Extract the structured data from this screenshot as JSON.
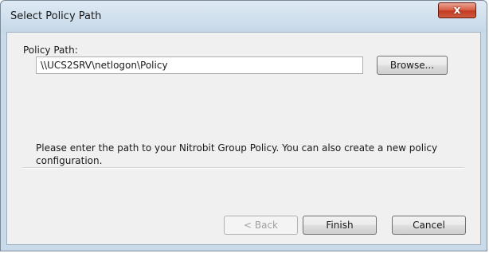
{
  "window": {
    "title": "Select Policy Path",
    "close_label": "x"
  },
  "form": {
    "policy_path_label": "Policy Path:",
    "policy_path_value": "\\\\UCS2SRV\\netlogon\\Policy",
    "browse_label": "Browse...",
    "description": "Please enter the path to your Nitrobit Group Policy. You can also create a new policy configuration."
  },
  "buttons": {
    "back": "< Back",
    "finish": "Finish",
    "cancel": "Cancel"
  }
}
